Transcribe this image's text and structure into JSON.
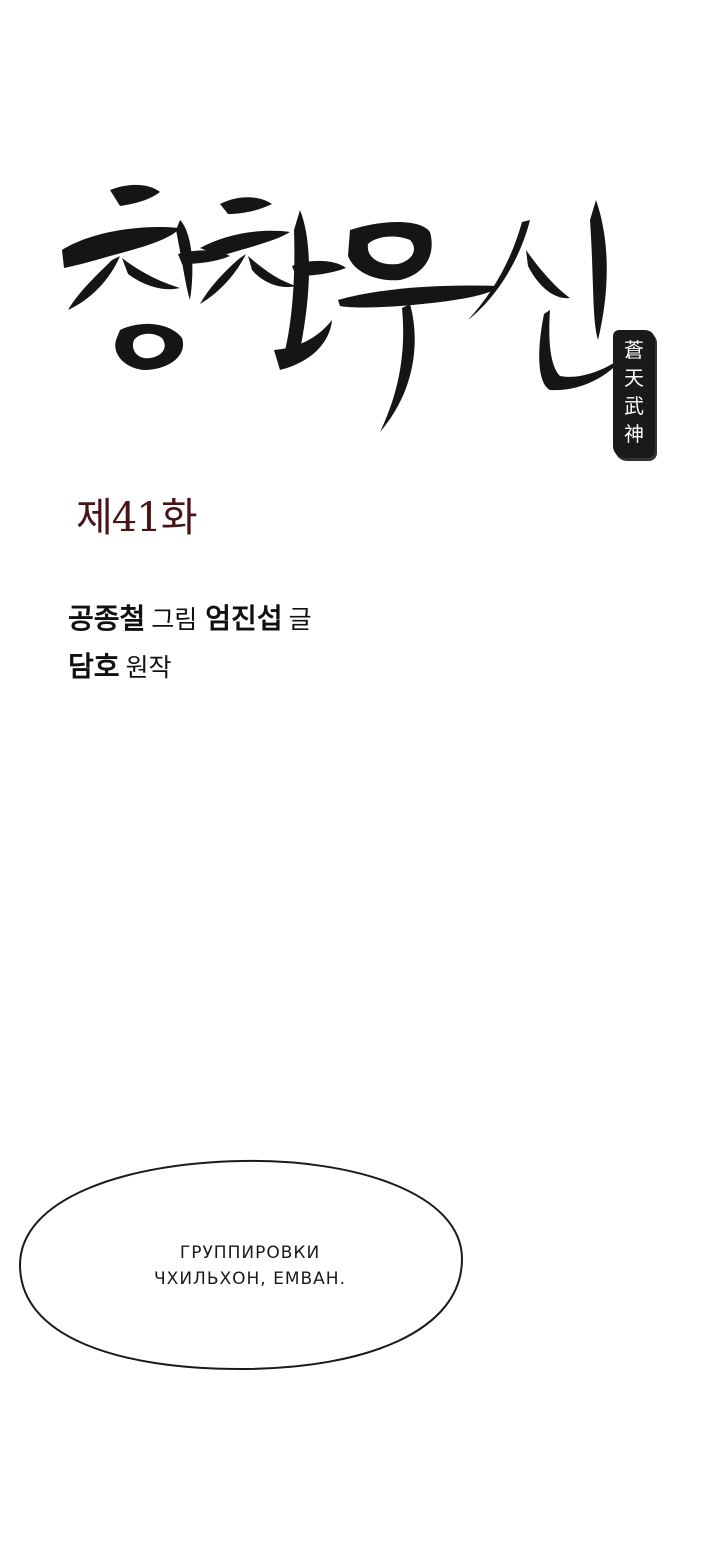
{
  "logo": {
    "korean_title": "창천무신",
    "hanja_seal": [
      "蒼",
      "天",
      "武",
      "神"
    ]
  },
  "episode": {
    "label": "제41화"
  },
  "credits": {
    "line1": [
      {
        "name": "공종철",
        "role": "그림"
      },
      {
        "name": "엄진섭",
        "role": "글"
      }
    ],
    "line2": [
      {
        "name": "담호",
        "role": "원작"
      }
    ]
  },
  "speech_bubble": {
    "lines": [
      "ГРУППИРОВКИ",
      "ЧХИЛЬХОН, ЕМВАН."
    ]
  },
  "colors": {
    "background": "#ffffff",
    "ink": "#151515",
    "episode": "#4a1416"
  }
}
